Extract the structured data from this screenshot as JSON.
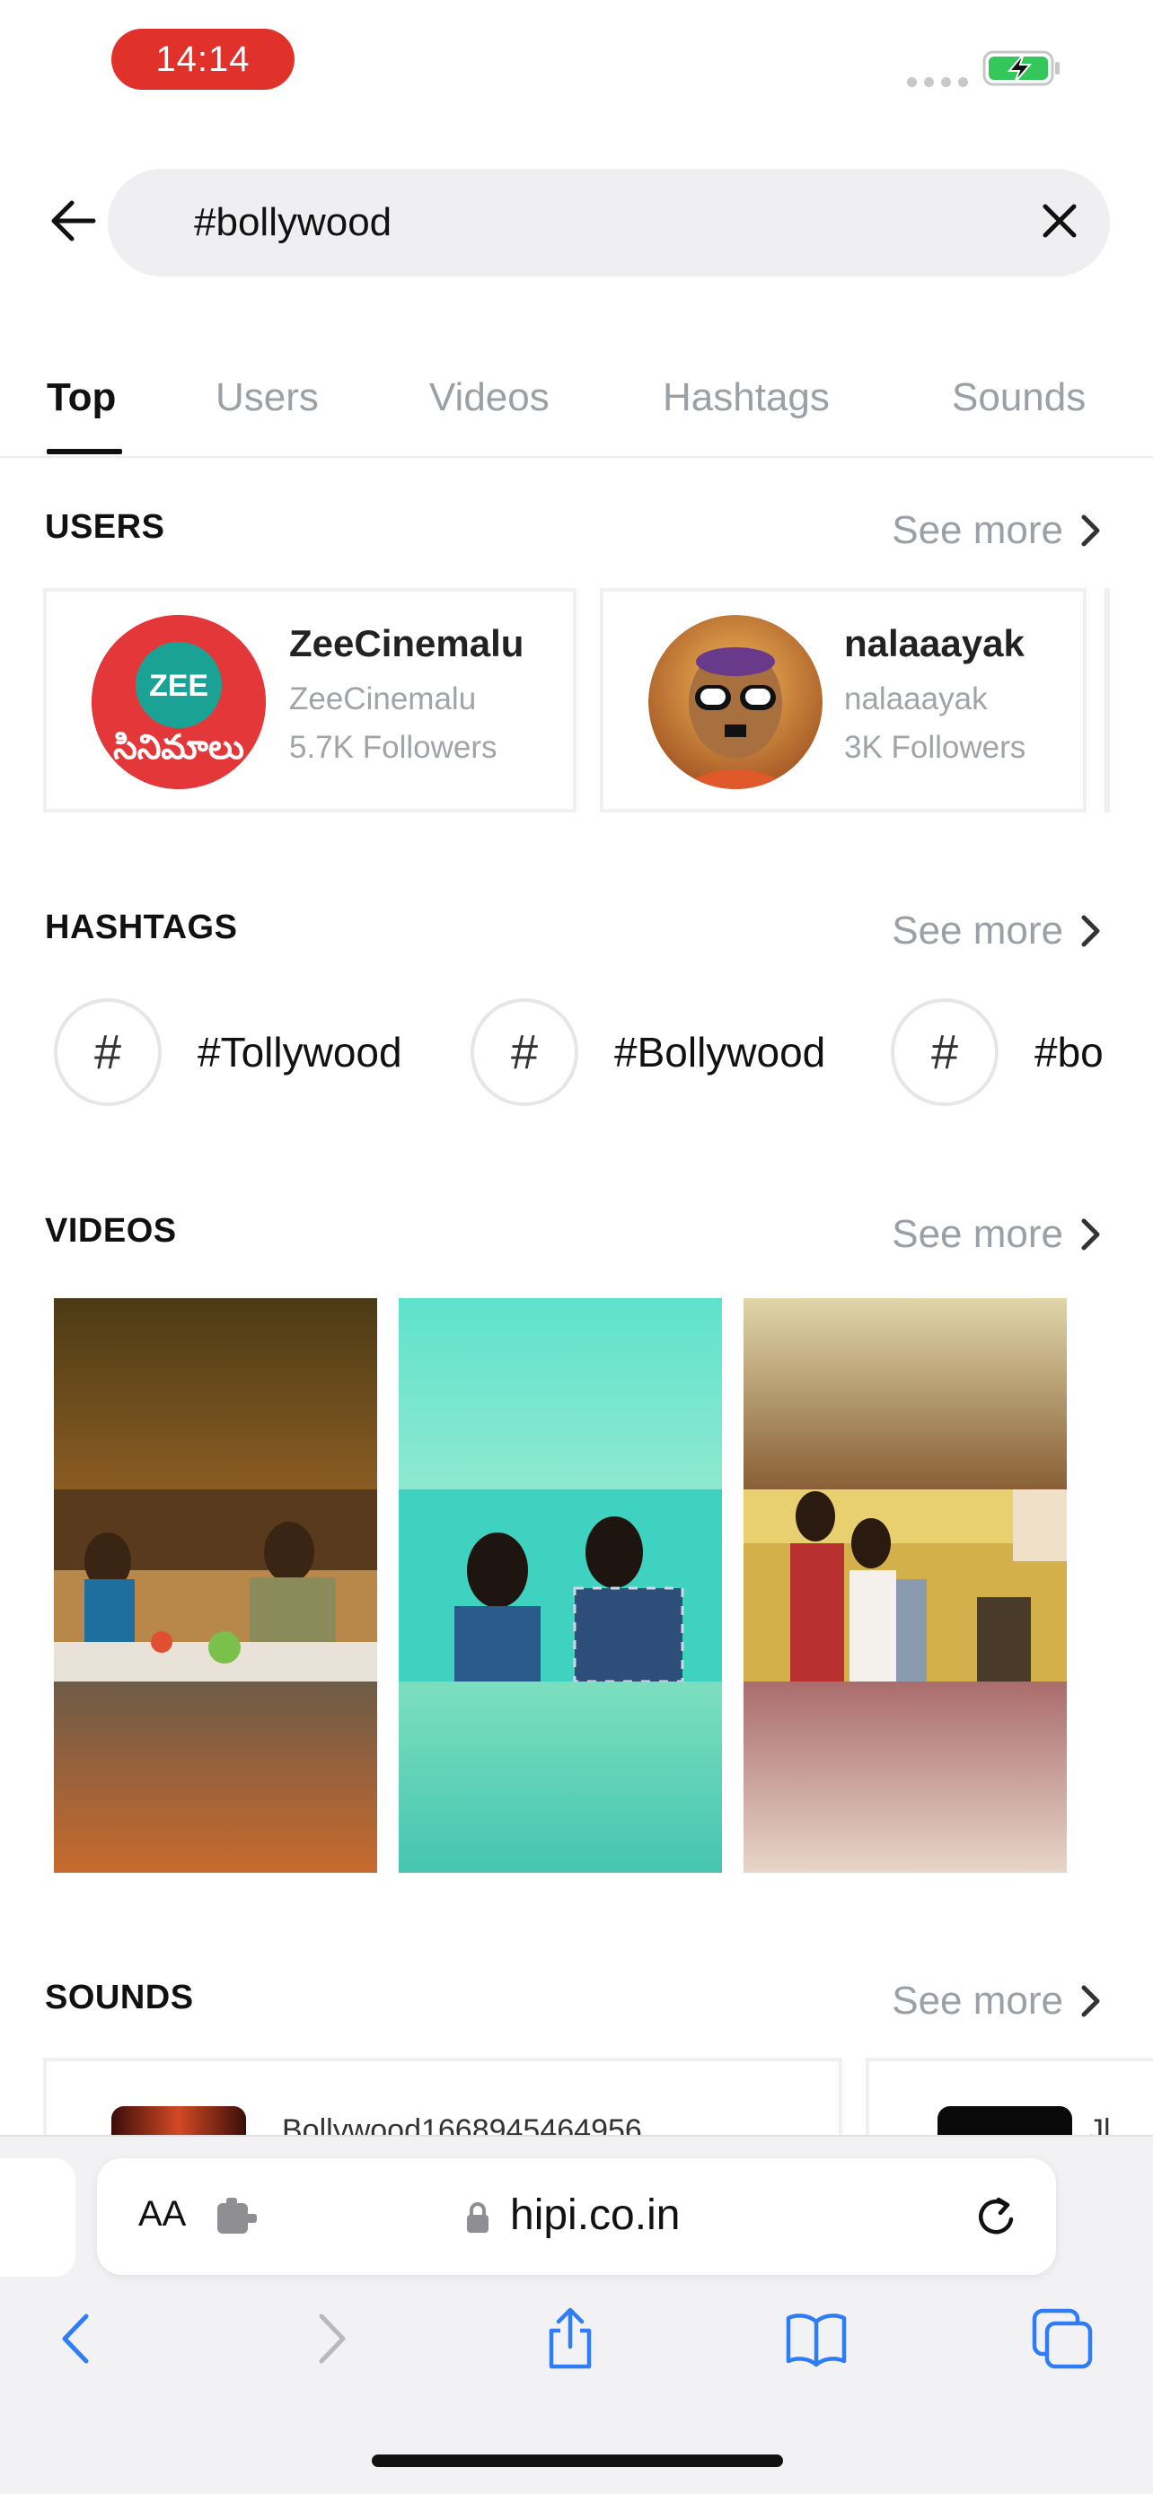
{
  "status_bar": {
    "time": "14:14"
  },
  "search": {
    "query": "#bollywood"
  },
  "tabs": [
    {
      "label": "Top"
    },
    {
      "label": "Users"
    },
    {
      "label": "Videos"
    },
    {
      "label": "Hashtags"
    },
    {
      "label": "Sounds"
    }
  ],
  "sections": {
    "users": {
      "title": "USERS",
      "see_more": "See more"
    },
    "hashtags": {
      "title": "HASHTAGS",
      "see_more": "See more"
    },
    "videos": {
      "title": "VIDEOS",
      "see_more": "See more"
    },
    "sounds": {
      "title": "SOUNDS",
      "see_more": "See more"
    }
  },
  "users": [
    {
      "name": "ZeeCinemalu",
      "handle": "ZeeCinemalu",
      "followers": "5.7K Followers",
      "avatar_logo": "ZEE",
      "avatar_sub": "సినిమాలు"
    },
    {
      "name": "nalaaayak",
      "handle": "nalaaayak",
      "followers": "3K Followers"
    }
  ],
  "hashtags": [
    {
      "symbol": "#",
      "label": "#Tollywood"
    },
    {
      "symbol": "#",
      "label": "#Bollywood"
    },
    {
      "symbol": "#",
      "label": "#bo"
    }
  ],
  "sounds": [
    {
      "title": "Bollywood1668945464956"
    },
    {
      "title": "Jl"
    }
  ],
  "browser": {
    "aa_label": "AA",
    "url": "hipi.co.in"
  },
  "colors": {
    "accent_red": "#e0312b",
    "battery_green": "#34c759",
    "safari_blue": "#2f7df6",
    "muted_gray": "#9aa0a6"
  }
}
